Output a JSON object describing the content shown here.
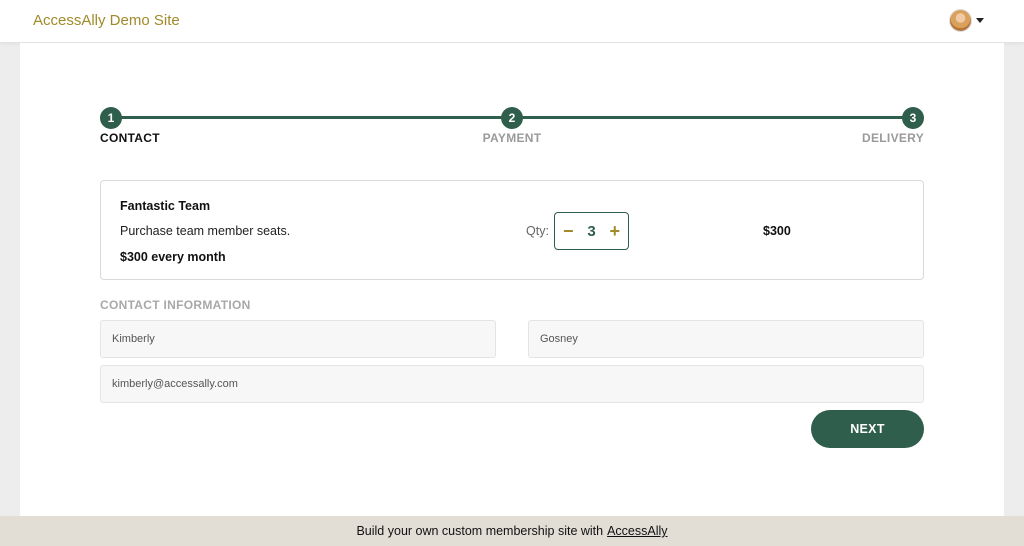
{
  "header": {
    "site_title": "AccessAlly Demo Site",
    "account_icon": "user-avatar"
  },
  "steps": [
    {
      "number": "1",
      "label": "CONTACT",
      "active": true
    },
    {
      "number": "2",
      "label": "PAYMENT",
      "active": false
    },
    {
      "number": "3",
      "label": "DELIVERY",
      "active": false
    }
  ],
  "product": {
    "name": "Fantastic Team",
    "description": "Purchase team member seats.",
    "price": "$300 every month",
    "qty_label": "Qty:",
    "qty_minus": "−",
    "qty_value": "3",
    "qty_plus": "+",
    "line_total": "$300"
  },
  "contact": {
    "section_title": "CONTACT INFORMATION",
    "first_name": "Kimberly",
    "last_name": "Gosney",
    "email": "kimberly@accessally.com"
  },
  "actions": {
    "next_label": "NEXT"
  },
  "footer": {
    "text": "Build your own custom membership site with",
    "link": "AccessAlly"
  },
  "colors": {
    "accent_green": "#2f5e4c",
    "brand_gold": "#a08a2a"
  }
}
